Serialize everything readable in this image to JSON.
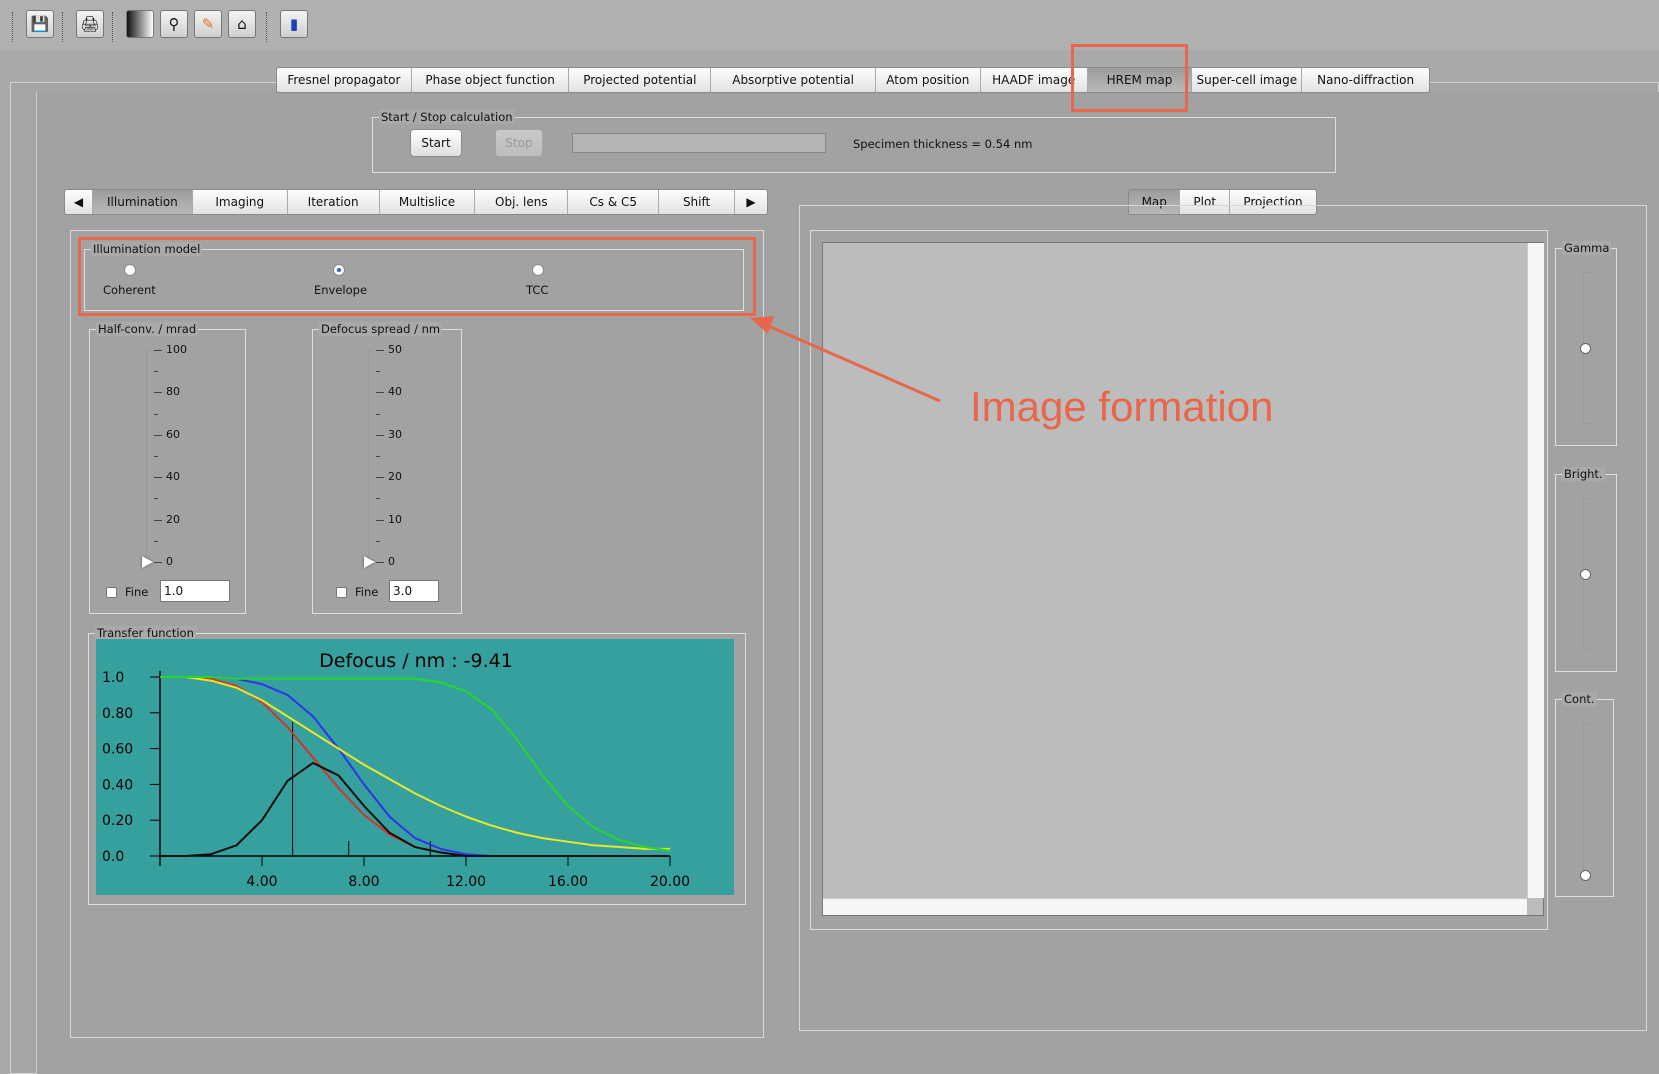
{
  "toolbar": {
    "icons": [
      "save-icon",
      "print-icon",
      "gradient-icon",
      "microscope-icon",
      "edit-icon",
      "peak-icon",
      "book-icon"
    ]
  },
  "top_tabs": [
    "Fresnel propagator",
    "Phase object function",
    "Projected potential",
    "Absorptive potential",
    "Atom position",
    "HAADF image",
    "HREM map",
    "Super-cell image",
    "Nano-diffraction"
  ],
  "top_tabs_selected": "HREM map",
  "calc": {
    "group_label": "Start / Stop calculation",
    "start_label": "Start",
    "stop_label": "Stop",
    "thickness_text": "Specimen thickness = 0.54 nm"
  },
  "left_tabs": [
    "Illumination",
    "Imaging",
    "Iteration",
    "Multislice",
    "Obj. lens",
    "Cs & C5",
    "Shift"
  ],
  "left_tabs_selected": "Illumination",
  "illumination": {
    "group_label": "Illumination model",
    "options": [
      "Coherent",
      "Envelope",
      "TCC"
    ],
    "selected": "Envelope"
  },
  "half_conv": {
    "group_label": "Half-conv. / mrad",
    "ticks": [
      "100",
      "80",
      "60",
      "40",
      "20",
      "0"
    ],
    "fine_label": "Fine",
    "value": "1.0"
  },
  "defocus_spread": {
    "group_label": "Defocus spread / nm",
    "ticks": [
      "50",
      "40",
      "30",
      "20",
      "10",
      "0"
    ],
    "fine_label": "Fine",
    "value": "3.0"
  },
  "transfer": {
    "group_label": "Transfer function",
    "background": "#36a09f"
  },
  "chart_data": {
    "type": "line",
    "title": "Defocus / nm : -9.41",
    "xlim": [
      0,
      20
    ],
    "ylim": [
      0,
      1
    ],
    "x_ticks": [
      "4.00",
      "8.00",
      "12.00",
      "16.00",
      "20.00"
    ],
    "y_ticks": [
      "1.0",
      "0.80",
      "0.60",
      "0.40",
      "0.20",
      "0.0"
    ],
    "x": [
      0,
      1,
      2,
      3,
      4,
      5,
      6,
      7,
      8,
      9,
      10,
      11,
      12,
      13,
      14,
      15,
      16,
      17,
      18,
      19,
      20
    ],
    "series": [
      {
        "color": "#2a36e8",
        "values": [
          1.0,
          1.0,
          1.0,
          0.99,
          0.96,
          0.9,
          0.78,
          0.6,
          0.4,
          0.22,
          0.1,
          0.04,
          0.01,
          0.0,
          0.0,
          0.0,
          0.0,
          0.0,
          0.0,
          0.0,
          0.0
        ]
      },
      {
        "color": "#d0342c",
        "values": [
          1.0,
          1.0,
          0.99,
          0.95,
          0.86,
          0.72,
          0.55,
          0.38,
          0.23,
          0.12,
          0.05,
          0.02,
          0.0,
          0.0,
          0.0,
          0.0,
          0.0,
          0.0,
          0.0,
          0.0,
          0.0
        ]
      },
      {
        "color": "#e8e82a",
        "values": [
          1.0,
          1.0,
          0.98,
          0.94,
          0.87,
          0.78,
          0.69,
          0.6,
          0.51,
          0.43,
          0.35,
          0.28,
          0.22,
          0.17,
          0.13,
          0.1,
          0.08,
          0.06,
          0.05,
          0.04,
          0.04
        ]
      },
      {
        "color": "#2ad42a",
        "values": [
          1.0,
          1.0,
          1.0,
          0.99,
          0.99,
          0.99,
          0.99,
          0.99,
          0.99,
          0.99,
          0.99,
          0.97,
          0.92,
          0.82,
          0.65,
          0.45,
          0.28,
          0.16,
          0.09,
          0.05,
          0.03
        ]
      },
      {
        "color": "#101010",
        "values": [
          0.0,
          0.0,
          0.01,
          0.06,
          0.2,
          0.42,
          0.52,
          0.45,
          0.28,
          0.13,
          0.05,
          0.02,
          0.0,
          0.0,
          0.0,
          0.0,
          0.0,
          0.0,
          0.0,
          0.0,
          0.0
        ]
      }
    ],
    "vertical_markers_x": [
      5.2,
      7.4,
      10.6
    ]
  },
  "right_tabs": [
    "Map",
    "Plot",
    "Projection"
  ],
  "right_tabs_selected": "Map",
  "sliders": [
    {
      "label": "Gamma",
      "level": 0.5
    },
    {
      "label": "Bright.",
      "level": 0.5
    },
    {
      "label": "Cont.",
      "level": 0.0
    }
  ],
  "annotation": {
    "text": "Image formation",
    "color": "#e8674c"
  }
}
